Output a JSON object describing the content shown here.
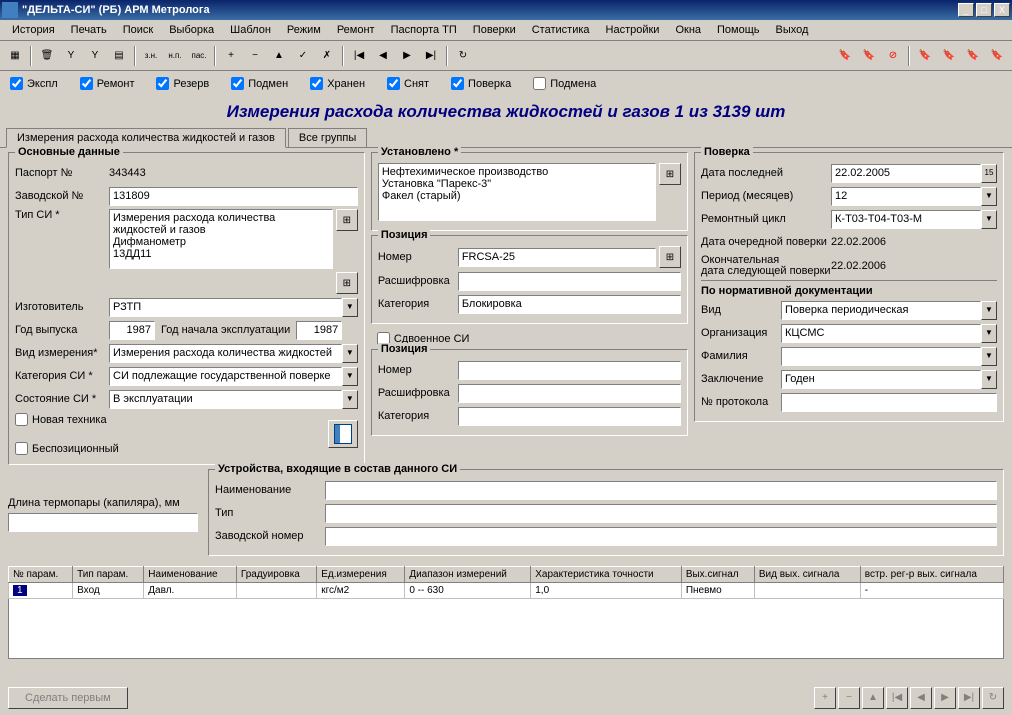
{
  "window": {
    "title": "\"ДЕЛЬТА-СИ\" (РБ) АРМ Метролога"
  },
  "menu": [
    "История",
    "Печать",
    "Поиск",
    "Выборка",
    "Шаблон",
    "Режим",
    "Ремонт",
    "Паспорта ТП",
    "Поверки",
    "Статистика",
    "Настройки",
    "Окна",
    "Помощь",
    "Выход"
  ],
  "toolbar_text": [
    "з.н.",
    "н.п.",
    "пас."
  ],
  "filters": {
    "ekspl": "Экспл",
    "remont": "Ремонт",
    "rezerv": "Резерв",
    "podmen": "Подмен",
    "hranen": "Хранен",
    "snyat": "Снят",
    "poverka": "Поверка",
    "podmena": "Подмена"
  },
  "main_title": "Измерения расхода количества жидкостей и газов   1 из 3139 шт",
  "tabs": [
    "Измерения расхода количества жидкостей и газов",
    "Все группы"
  ],
  "basic": {
    "title": "Основные данные",
    "passport_lbl": "Паспорт №",
    "passport": "343443",
    "zavod_lbl": "Заводской №",
    "zavod": "131809",
    "tip_si_lbl": "Тип СИ *",
    "tip_si": "Измерения расхода количества жидкостей и газов\nДифманометр\n13ДД11",
    "izgot_lbl": "Изготовитель",
    "izgot": "РЗТП",
    "god_vyp_lbl": "Год выпуска",
    "god_vyp": "1987",
    "god_nach_lbl": "Год начала эксплуатации",
    "god_nach": "1987",
    "vid_izm_lbl": "Вид измерения*",
    "vid_izm": "Измерения расхода количества жидкостей",
    "kat_si_lbl": "Категория СИ *",
    "kat_si": "СИ подлежащие государственной поверке",
    "sost_si_lbl": "Состояние СИ *",
    "sost_si": "В эксплуатации",
    "nov_tech": "Новая техника",
    "bespoz": "Беспозиционный"
  },
  "install": {
    "title": "Установлено *",
    "text": "Нефтехимическое производство\nУстановка \"Парекс-3\"\nФакел (старый)"
  },
  "pos": {
    "title": "Позиция",
    "nomer_lbl": "Номер",
    "nomer": "FRCSA-25",
    "rash_lbl": "Расшифровка",
    "rash": "",
    "kat_lbl": "Категория",
    "kat": "Блокировка"
  },
  "sdvoe": "Сдвоенное СИ",
  "pos2": {
    "title": "Позиция",
    "nomer_lbl": "Номер",
    "rash_lbl": "Расшифровка",
    "kat_lbl": "Категория"
  },
  "check": {
    "title": "Поверка",
    "last_lbl": "Дата последней",
    "last": "22.02.2005",
    "period_lbl": "Период  (месяцев)",
    "period": "12",
    "cycle_lbl": "Ремонтный цикл",
    "cycle": "К-Т03-Т04-Т03-М",
    "next_lbl": "Дата очередной поверки",
    "next": "22.02.2006",
    "final_lbl": "Окончательная\nдата следующей поверки",
    "final": "22.02.2006",
    "norm_title": "По нормативной документации",
    "vid_lbl": "Вид",
    "vid": "Поверка периодическая",
    "org_lbl": "Организация",
    "org": "КЦСМС",
    "fam_lbl": "Фамилия",
    "fam": "",
    "zakl_lbl": "Заключение",
    "zakl": "Годен",
    "proto_lbl": "№ протокола",
    "proto": ""
  },
  "ustr": {
    "title": "Устройства, входящие  в состав данного СИ",
    "naim_lbl": "Наименование",
    "tip_lbl": "Тип",
    "zn_lbl": "Заводской номер"
  },
  "dlina_lbl": "Длина термопары (капиляра), мм",
  "grid": {
    "headers": [
      "№ парам.",
      "Тип парам.",
      "Наименование",
      "Градуировка",
      "Ед.измерения",
      "Диапазон измерений",
      "Характеристика точности",
      "Вых.сигнал",
      "Вид вых. сигнала",
      "встр. рег-р вых. сигнала"
    ],
    "row": [
      "1",
      "Вход",
      "Давл.",
      "",
      "кгс/м2",
      "0 -- 630",
      "1,0",
      "Пневмо",
      "",
      "-"
    ]
  },
  "bottom_btn": "Сделать первым"
}
